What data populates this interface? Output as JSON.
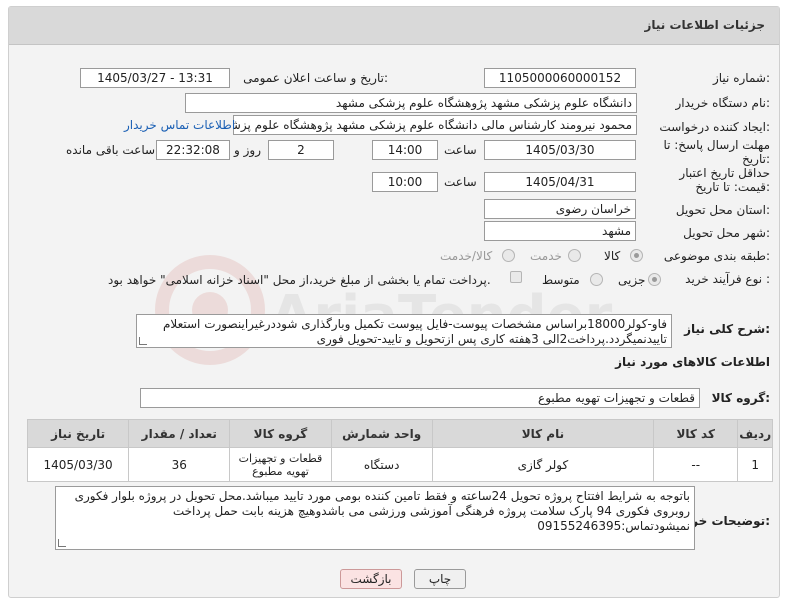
{
  "header": {
    "title": "جزئیات اطلاعات نیاز"
  },
  "fields": {
    "need_number_label": "شماره نیاز:",
    "need_number": "1105000060000152",
    "announce_label": "تاریخ و ساعت اعلان عمومی:",
    "announce_value": "1405/03/27 - 13:31",
    "buyer_org_label": "نام دستگاه خریدار:",
    "buyer_org": "دانشگاه علوم پزشکی مشهد   پژوهشگاه علوم پزشکی مشهد",
    "creator_label": "ایجاد کننده درخواست:",
    "creator": "محمود نیرومند کارشناس مالی دانشگاه علوم پزشکی مشهد   پژوهشگاه علوم پزشکی مشهد",
    "contact_link": "اطلاعات تماس خریدار",
    "deadline_label": "مهلت ارسال پاسخ: تا تاریخ:",
    "deadline_date": "1405/03/30",
    "time_label": "ساعت",
    "deadline_time": "14:00",
    "days_count": "2",
    "days_label": "روز و",
    "remaining_time": "22:32:08",
    "remaining_label": "ساعت باقی مانده",
    "validity_label": "حداقل تاریخ اعتبار قیمت: تا تاریخ:",
    "validity_date": "1405/04/31",
    "validity_time_label": "ساعت",
    "validity_time": "10:00",
    "province_label": "استان محل تحویل:",
    "province": "خراسان رضوی",
    "city_label": "شهر محل تحویل:",
    "city": "مشهد",
    "category_label": "طبقه بندی موضوعی:",
    "category_options": [
      "کالا",
      "خدمت",
      "کالا/خدمت"
    ],
    "process_label": "نوع فرآیند خرید :",
    "process_options": [
      "جزیی",
      "متوسط"
    ],
    "payment_note": "پرداخت تمام یا بخشی از مبلغ خرید،از محل \"اسناد خزانه اسلامی\" خواهد بود.",
    "description_label": "شرح کلی نیاز:",
    "description": "فاو-کولر18000براساس مشخصات پیوست-فایل پیوست تکمیل وبارگذاری شوددرغیراینصورت استعلام تاییدنمیگردد.پرداخت2الی 3هفته کاری پس ازتحویل و تایید-تحویل فوری",
    "goods_info_title": "اطلاعات کالاهای مورد نیاز",
    "goods_group_label": "گروه کالا:",
    "goods_group": "قطعات و تجهیزات تهویه مطبوع",
    "buyer_notes_label": "توضیحات خریدار:",
    "buyer_notes": "باتوجه به شرایط افتتاح پروژه تحویل 24ساعته و فقط تامین کننده بومی مورد تایید میباشد.محل تحویل در پروژه بلوار فکوری روبروی فکوری 94 پارک سلامت پروژه فرهنگی آموزشی ورزشی می باشدوهیچ هزینه بابت حمل  پرداخت نمیشودتماس:09155246395"
  },
  "table": {
    "headers": [
      "ردیف",
      "کد کالا",
      "نام کالا",
      "واحد شمارش",
      "گروه کالا",
      "تعداد / مقدار",
      "تاریخ نیاز"
    ],
    "rows": [
      [
        "1",
        "--",
        "کولر گازی",
        "دستگاه",
        "قطعات و تجهیزات تهویه مطبوع",
        "36",
        "1405/03/30"
      ]
    ]
  },
  "buttons": {
    "print": "چاپ",
    "back": "بازگشت"
  },
  "watermark": {
    "text": "AriaTender.net"
  },
  "colors": {
    "header_bg": "#d9d9d9",
    "link": "#1a5fb4",
    "back_btn_bg": "#fbe3e3"
  }
}
